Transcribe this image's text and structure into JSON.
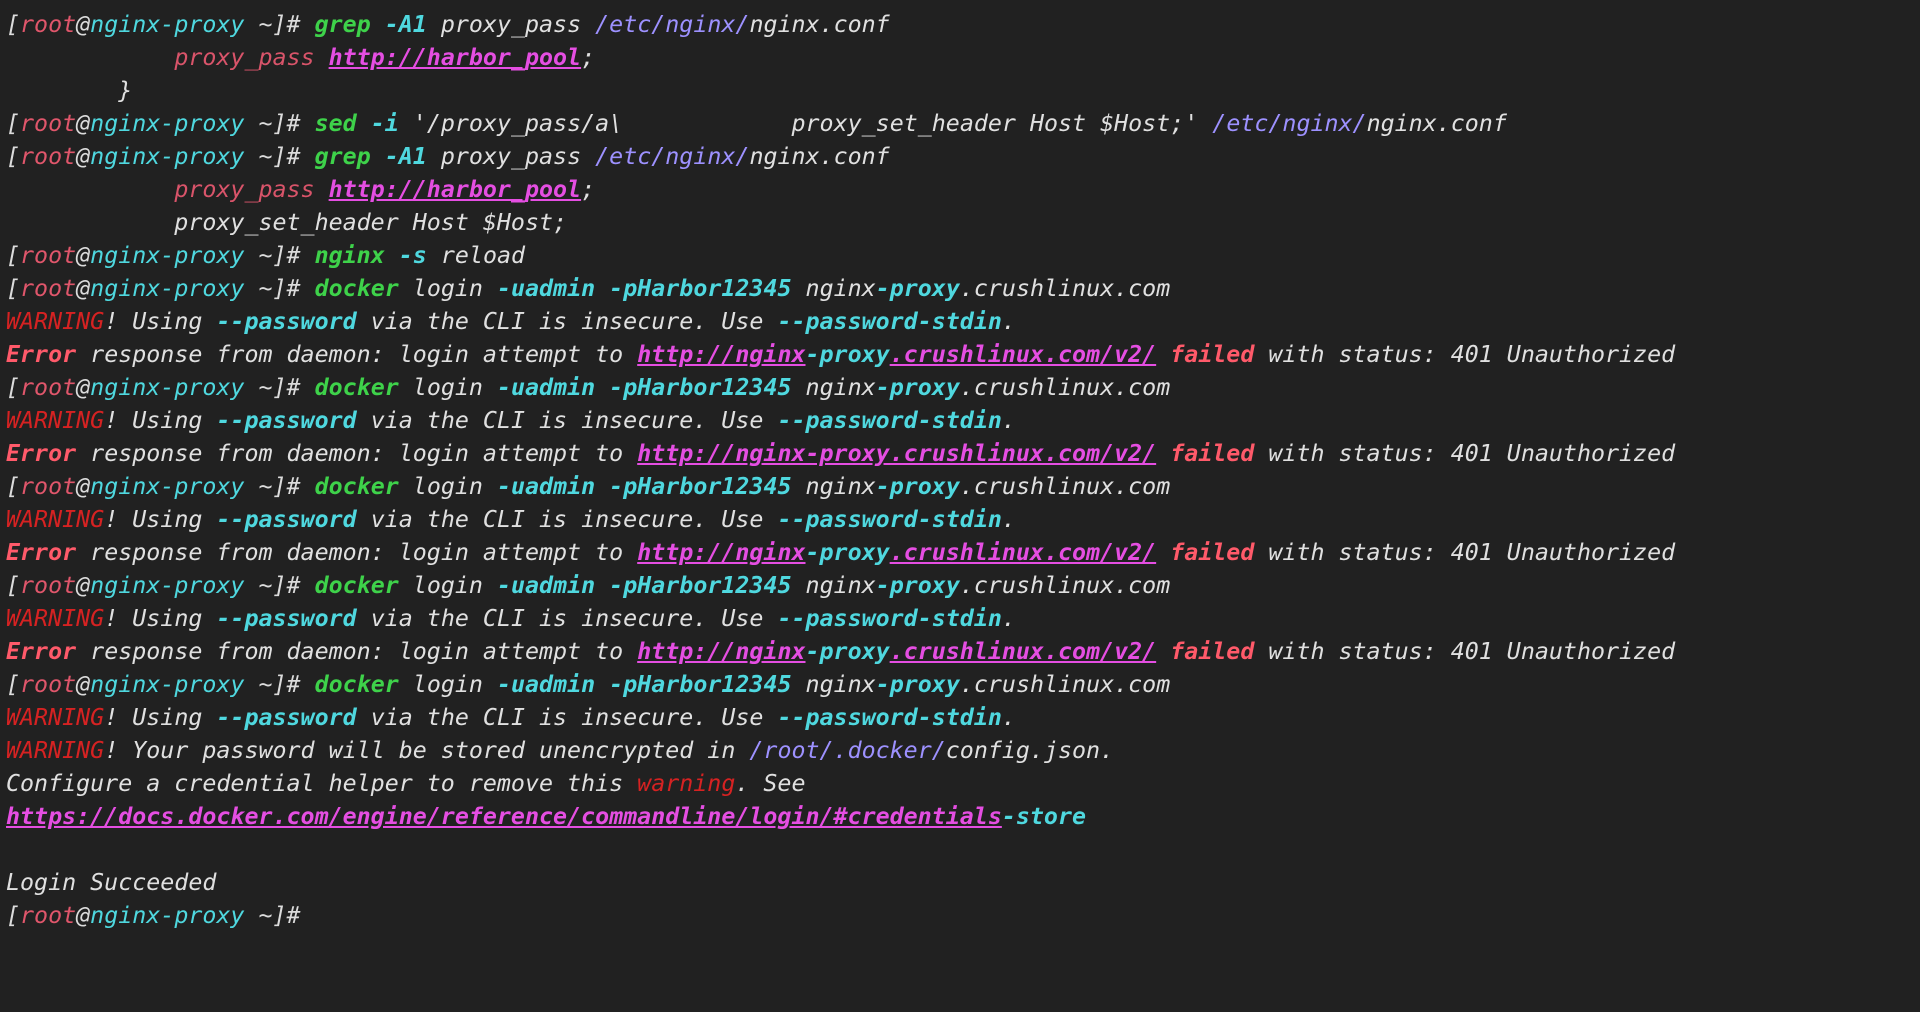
{
  "colors": {
    "background": "#212121",
    "default": "#e0e0e0",
    "bracket": "#dcdcdc",
    "user": "#e0566b",
    "host": "#4fd8df",
    "command": "#3ed24a",
    "flag": "#4fd8df",
    "path": "#9d91ff",
    "url": "#e54ee2",
    "directive": "#d9546a",
    "warning": "#d62222",
    "error": "#ff5a6a"
  },
  "lines": [
    [
      [
        "bracket",
        "["
      ],
      [
        "user",
        "root"
      ],
      [
        "bracket",
        "@"
      ],
      [
        "host",
        "nginx-proxy"
      ],
      [
        "bracket",
        " ~]# "
      ],
      [
        "command",
        "grep",
        1
      ],
      [
        "default",
        " "
      ],
      [
        "flag",
        "-A1",
        1
      ],
      [
        "default",
        " proxy_pass "
      ],
      [
        "path",
        "/etc/nginx/"
      ],
      [
        "default",
        "nginx.conf"
      ]
    ],
    [
      [
        "default",
        "            "
      ],
      [
        "directive",
        "proxy_pass"
      ],
      [
        "default",
        " "
      ],
      [
        "url",
        "http://harbor_pool",
        1,
        1
      ],
      [
        "default",
        ";"
      ]
    ],
    [
      [
        "default",
        "        }"
      ]
    ],
    [
      [
        "bracket",
        "["
      ],
      [
        "user",
        "root"
      ],
      [
        "bracket",
        "@"
      ],
      [
        "host",
        "nginx-proxy"
      ],
      [
        "bracket",
        " ~]# "
      ],
      [
        "command",
        "sed",
        1
      ],
      [
        "default",
        " "
      ],
      [
        "flag",
        "-i",
        1
      ],
      [
        "default",
        " '/proxy_pass/a\\            proxy_set_header Host $Host;' "
      ],
      [
        "path",
        "/etc/nginx/"
      ],
      [
        "default",
        "nginx.conf"
      ]
    ],
    [
      [
        "bracket",
        "["
      ],
      [
        "user",
        "root"
      ],
      [
        "bracket",
        "@"
      ],
      [
        "host",
        "nginx-proxy"
      ],
      [
        "bracket",
        " ~]# "
      ],
      [
        "command",
        "grep",
        1
      ],
      [
        "default",
        " "
      ],
      [
        "flag",
        "-A1",
        1
      ],
      [
        "default",
        " proxy_pass "
      ],
      [
        "path",
        "/etc/nginx/"
      ],
      [
        "default",
        "nginx.conf"
      ]
    ],
    [
      [
        "default",
        "            "
      ],
      [
        "directive",
        "proxy_pass"
      ],
      [
        "default",
        " "
      ],
      [
        "url",
        "http://harbor_pool",
        1,
        1
      ],
      [
        "default",
        ";"
      ]
    ],
    [
      [
        "default",
        "            proxy_set_header Host $Host;"
      ]
    ],
    [
      [
        "bracket",
        "["
      ],
      [
        "user",
        "root"
      ],
      [
        "bracket",
        "@"
      ],
      [
        "host",
        "nginx-proxy"
      ],
      [
        "bracket",
        " ~]# "
      ],
      [
        "command",
        "nginx",
        1
      ],
      [
        "default",
        " "
      ],
      [
        "flag",
        "-s",
        1
      ],
      [
        "default",
        " reload"
      ]
    ],
    [
      [
        "bracket",
        "["
      ],
      [
        "user",
        "root"
      ],
      [
        "bracket",
        "@"
      ],
      [
        "host",
        "nginx-proxy"
      ],
      [
        "bracket",
        " ~]# "
      ],
      [
        "command",
        "docker",
        1
      ],
      [
        "default",
        " login "
      ],
      [
        "flag",
        "-uadmin",
        1
      ],
      [
        "default",
        " "
      ],
      [
        "flag",
        "-pHarbor12345",
        1
      ],
      [
        "default",
        " "
      ],
      [
        "default",
        "nginx"
      ],
      [
        "host",
        "-proxy",
        1
      ],
      [
        "default",
        ".crushlinux.com"
      ]
    ],
    [
      [
        "warning",
        "WARNING"
      ],
      [
        "default",
        "! Using "
      ],
      [
        "flag",
        "--password",
        1
      ],
      [
        "default",
        " via the CLI is insecure. Use "
      ],
      [
        "flag",
        "--password-stdin",
        1
      ],
      [
        "default",
        "."
      ]
    ],
    [
      [
        "error",
        "Error",
        1
      ],
      [
        "default",
        " response from daemon: login attempt to "
      ],
      [
        "url",
        "http://nginx",
        1,
        1
      ],
      [
        "host",
        "-proxy",
        1
      ],
      [
        "url",
        ".crushlinux.com/v2/",
        1,
        1
      ],
      [
        "default",
        " "
      ],
      [
        "error",
        "failed",
        1
      ],
      [
        "default",
        " with status: 401 Unauthorized"
      ]
    ],
    [
      [
        "bracket",
        "["
      ],
      [
        "user",
        "root"
      ],
      [
        "bracket",
        "@"
      ],
      [
        "host",
        "nginx-proxy"
      ],
      [
        "bracket",
        " ~]# "
      ],
      [
        "command",
        "docker",
        1
      ],
      [
        "default",
        " login "
      ],
      [
        "flag",
        "-uadmin",
        1
      ],
      [
        "default",
        " "
      ],
      [
        "flag",
        "-pHarbor12345",
        1
      ],
      [
        "default",
        " "
      ],
      [
        "default",
        "nginx"
      ],
      [
        "host",
        "-proxy",
        1
      ],
      [
        "default",
        ".crushlinux.com"
      ]
    ],
    [
      [
        "warning",
        "WARNING"
      ],
      [
        "default",
        "! Using "
      ],
      [
        "flag",
        "--password",
        1
      ],
      [
        "default",
        " via the CLI is insecure. Use "
      ],
      [
        "flag",
        "--password-stdin",
        1
      ],
      [
        "default",
        "."
      ]
    ],
    [
      [
        "error",
        "Error",
        1
      ],
      [
        "default",
        " response from daemon: login attempt to "
      ],
      [
        "url",
        "http://nginx-proxy.crushlinux.com/v2/",
        1,
        1
      ],
      [
        "default",
        " "
      ],
      [
        "error",
        "failed",
        1
      ],
      [
        "default",
        " with status: 401 Unauthorized"
      ]
    ],
    [
      [
        "bracket",
        "["
      ],
      [
        "user",
        "root"
      ],
      [
        "bracket",
        "@"
      ],
      [
        "host",
        "nginx-proxy"
      ],
      [
        "bracket",
        " ~]# "
      ],
      [
        "command",
        "docker",
        1
      ],
      [
        "default",
        " login "
      ],
      [
        "flag",
        "-uadmin",
        1
      ],
      [
        "default",
        " "
      ],
      [
        "flag",
        "-pHarbor12345",
        1
      ],
      [
        "default",
        " "
      ],
      [
        "default",
        "nginx"
      ],
      [
        "host",
        "-proxy",
        1
      ],
      [
        "default",
        ".crushlinux.com"
      ]
    ],
    [
      [
        "warning",
        "WARNING"
      ],
      [
        "default",
        "! Using "
      ],
      [
        "flag",
        "--password",
        1
      ],
      [
        "default",
        " via the CLI is insecure. Use "
      ],
      [
        "flag",
        "--password-stdin",
        1
      ],
      [
        "default",
        "."
      ]
    ],
    [
      [
        "error",
        "Error",
        1
      ],
      [
        "default",
        " response from daemon: login attempt to "
      ],
      [
        "url",
        "http://nginx",
        1,
        1
      ],
      [
        "host",
        "-proxy",
        1
      ],
      [
        "url",
        ".crushlinux.com/v2/",
        1,
        1
      ],
      [
        "default",
        " "
      ],
      [
        "error",
        "failed",
        1
      ],
      [
        "default",
        " with status: 401 Unauthorized"
      ]
    ],
    [
      [
        "bracket",
        "["
      ],
      [
        "user",
        "root"
      ],
      [
        "bracket",
        "@"
      ],
      [
        "host",
        "nginx-proxy"
      ],
      [
        "bracket",
        " ~]# "
      ],
      [
        "command",
        "docker",
        1
      ],
      [
        "default",
        " login "
      ],
      [
        "flag",
        "-uadmin",
        1
      ],
      [
        "default",
        " "
      ],
      [
        "flag",
        "-pHarbor12345",
        1
      ],
      [
        "default",
        " "
      ],
      [
        "default",
        "nginx"
      ],
      [
        "host",
        "-proxy",
        1
      ],
      [
        "default",
        ".crushlinux.com"
      ]
    ],
    [
      [
        "warning",
        "WARNING"
      ],
      [
        "default",
        "! Using "
      ],
      [
        "flag",
        "--password",
        1
      ],
      [
        "default",
        " via the CLI is insecure. Use "
      ],
      [
        "flag",
        "--password-stdin",
        1
      ],
      [
        "default",
        "."
      ]
    ],
    [
      [
        "error",
        "Error",
        1
      ],
      [
        "default",
        " response from daemon: login attempt to "
      ],
      [
        "url",
        "http://nginx",
        1,
        1
      ],
      [
        "host",
        "-proxy",
        1
      ],
      [
        "url",
        ".crushlinux.com/v2/",
        1,
        1
      ],
      [
        "default",
        " "
      ],
      [
        "error",
        "failed",
        1
      ],
      [
        "default",
        " with status: 401 Unauthorized"
      ]
    ],
    [
      [
        "bracket",
        "["
      ],
      [
        "user",
        "root"
      ],
      [
        "bracket",
        "@"
      ],
      [
        "host",
        "nginx-proxy"
      ],
      [
        "bracket",
        " ~]# "
      ],
      [
        "command",
        "docker",
        1
      ],
      [
        "default",
        " login "
      ],
      [
        "flag",
        "-uadmin",
        1
      ],
      [
        "default",
        " "
      ],
      [
        "flag",
        "-pHarbor12345",
        1
      ],
      [
        "default",
        " "
      ],
      [
        "default",
        "nginx"
      ],
      [
        "host",
        "-proxy",
        1
      ],
      [
        "default",
        ".crushlinux.com"
      ]
    ],
    [
      [
        "warning",
        "WARNING"
      ],
      [
        "default",
        "! Using "
      ],
      [
        "flag",
        "--password",
        1
      ],
      [
        "default",
        " via the CLI is insecure. Use "
      ],
      [
        "flag",
        "--password-stdin",
        1
      ],
      [
        "default",
        "."
      ]
    ],
    [
      [
        "warning",
        "WARNING"
      ],
      [
        "default",
        "! Your password will be stored unencrypted in "
      ],
      [
        "path",
        "/root/.docker/"
      ],
      [
        "default",
        "config.json."
      ]
    ],
    [
      [
        "default",
        "Configure a credential helper to remove this "
      ],
      [
        "warning",
        "warning"
      ],
      [
        "default",
        ". See"
      ]
    ],
    [
      [
        "url",
        "https://docs.docker.com/engine/reference/commandline/login/#credentials",
        1,
        1
      ],
      [
        "host",
        "-store",
        1
      ]
    ],
    [],
    [
      [
        "default",
        "Login Succeeded"
      ]
    ],
    [
      [
        "bracket",
        "["
      ],
      [
        "user",
        "root"
      ],
      [
        "bracket",
        "@"
      ],
      [
        "host",
        "nginx-proxy"
      ],
      [
        "bracket",
        " ~]#"
      ]
    ]
  ]
}
